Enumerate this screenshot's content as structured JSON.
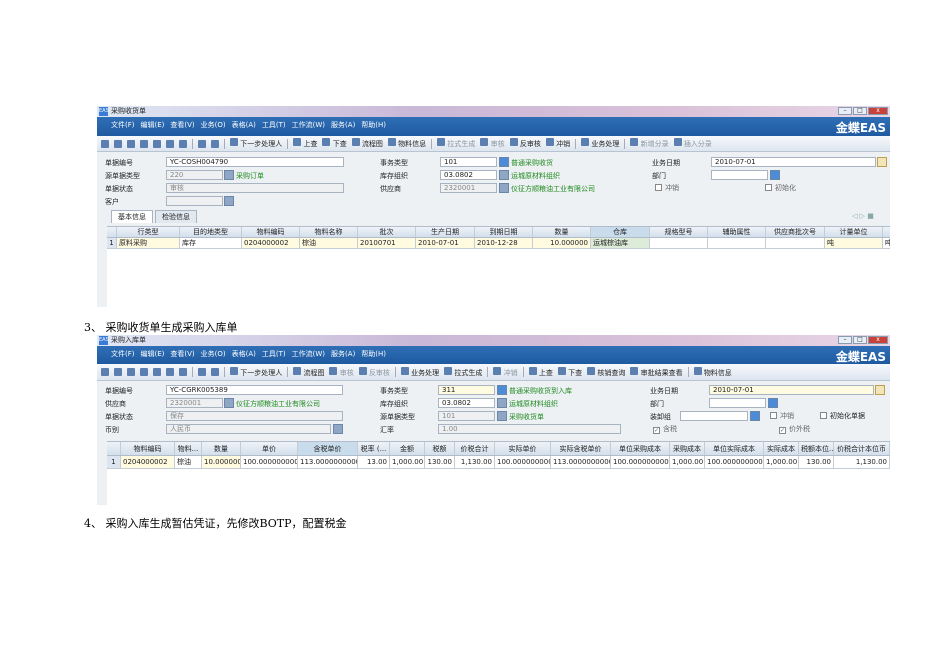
{
  "captions": [
    "3、 采购收货单生成采购入库单",
    "4、 采购入库生成暂估凭证，先修改BOTP，配置税金"
  ],
  "brand": "金蝶EAS",
  "menu": [
    "文件(F)",
    "编辑(E)",
    "查看(V)",
    "业务(O)",
    "表格(A)",
    "工具(T)",
    "工作流(W)",
    "服务(A)",
    "帮助(H)"
  ],
  "shot1": {
    "title": "采购收货单",
    "toolbar": [
      "下一步处理人",
      "上查",
      "下查",
      "流程图",
      "物料信息",
      "拉式生成",
      "审核",
      "反审核",
      "冲销",
      "业务处理",
      "新增分录",
      "插入分录"
    ],
    "fields": {
      "bill_no_label": "单据编号",
      "bill_no": "YC-COSH004790",
      "src_type_label": "源单据类型",
      "src_type": "220",
      "src_type_name": "采购订单",
      "status_label": "单据状态",
      "status": "审核",
      "customer_label": "客户",
      "biz_type_label": "事务类型",
      "biz_type": "101",
      "biz_type_name": "普通采购收货",
      "stock_org_label": "库存组织",
      "stock_org": "03.0802",
      "stock_org_name": "运城原材料组织",
      "supplier_label": "供应商",
      "supplier": "2320001",
      "supplier_name": "仪征方顺粮油工业有限公司",
      "biz_date_label": "业务日期",
      "biz_date": "2010-07-01",
      "dept_label": "部门",
      "reverse_label": "冲销",
      "init_label": "初始化"
    },
    "tabs": [
      "基本信息",
      "检验信息"
    ],
    "columns": [
      "",
      "行类型",
      "目的地类型",
      "物料编码",
      "物料名称",
      "批次",
      "生产日期",
      "到期日期",
      "数量",
      "仓库",
      "规格型号",
      "辅助属性",
      "供应商批次号",
      "计量单位",
      ""
    ],
    "rows": [
      [
        "1",
        "原料采购",
        "库存",
        "0204000002",
        "棕油",
        "20100701",
        "2010-07-01",
        "2010-12-28",
        "10.000000",
        "运城棕油库",
        "",
        "",
        "",
        "吨",
        "吨"
      ]
    ]
  },
  "shot2": {
    "title": "采购入库单",
    "toolbar": [
      "下一步处理人",
      "流程图",
      "审核",
      "反审核",
      "业务处理",
      "拉式生成",
      "冲销",
      "上查",
      "下查",
      "核销查询",
      "审批结果查看",
      "物料信息"
    ],
    "fields": {
      "bill_no_label": "单据编号",
      "bill_no": "YC-CGRK005389",
      "supplier_label": "供应商",
      "supplier": "2320001",
      "supplier_name": "仪征方顺粮油工业有限公司",
      "status_label": "单据状态",
      "status": "保存",
      "currency_label": "币别",
      "currency": "人民币",
      "biz_type_label": "事务类型",
      "biz_type": "311",
      "biz_type_name": "普通采购收货到入库",
      "stock_org_label": "库存组织",
      "stock_org": "03.0802",
      "stock_org_name": "运城原材料组织",
      "src_type_label": "源单据类型",
      "src_type": "101",
      "src_type_name": "采购收货单",
      "rate_label": "汇率",
      "rate": "1.00",
      "biz_date_label": "业务日期",
      "biz_date": "2010-07-01",
      "dept_label": "部门",
      "loader_label": "装卸组",
      "reverse_label": "冲销",
      "init_label": "初始化单据",
      "tax_incl_label": "含税",
      "tax_extra_label": "价外税"
    },
    "columns": [
      "",
      "物料编码",
      "物料...",
      "数量",
      "单价",
      "含税单价",
      "税率 (...",
      "金额",
      "税额",
      "价税合计",
      "实际单价",
      "实际含税单价",
      "单位采购成本",
      "采购成本",
      "单位实际成本",
      "实际成本",
      "税额本位...",
      "价税合计本位币"
    ],
    "rows": [
      [
        "1",
        "0204000002",
        "棕油",
        "10.000000",
        "100.0000000000",
        "113.0000000000",
        "13.00",
        "1,000.00",
        "130.00",
        "1,130.00",
        "100.0000000000",
        "113.0000000000",
        "100.0000000000",
        "1,000.00",
        "100.0000000000",
        "1,000.00",
        "130.00",
        "1,130.00"
      ]
    ]
  }
}
